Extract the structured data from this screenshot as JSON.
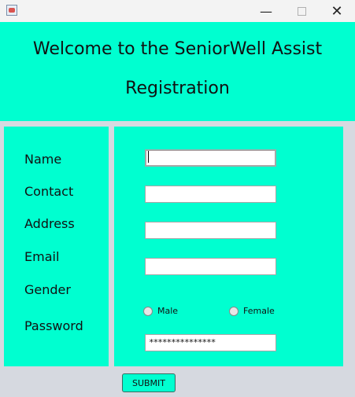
{
  "window": {
    "icon": "java-app-icon",
    "minimize_glyph": "—",
    "close_glyph": "✕"
  },
  "header": {
    "line1": "Welcome to the SeniorWell Assist",
    "line2": "Registration"
  },
  "form": {
    "labels": {
      "name": "Name",
      "contact": "Contact",
      "address": "Address",
      "email": "Email",
      "gender": "Gender",
      "password": "Password"
    },
    "values": {
      "name": "",
      "contact": "",
      "address": "",
      "email": "",
      "password_mask": "***************"
    },
    "gender_options": {
      "male": "Male",
      "female": "Female"
    },
    "submit_label": "SUBMIT"
  },
  "colors": {
    "accent": "#00ffd0",
    "window_bg": "#d6d9e0"
  }
}
